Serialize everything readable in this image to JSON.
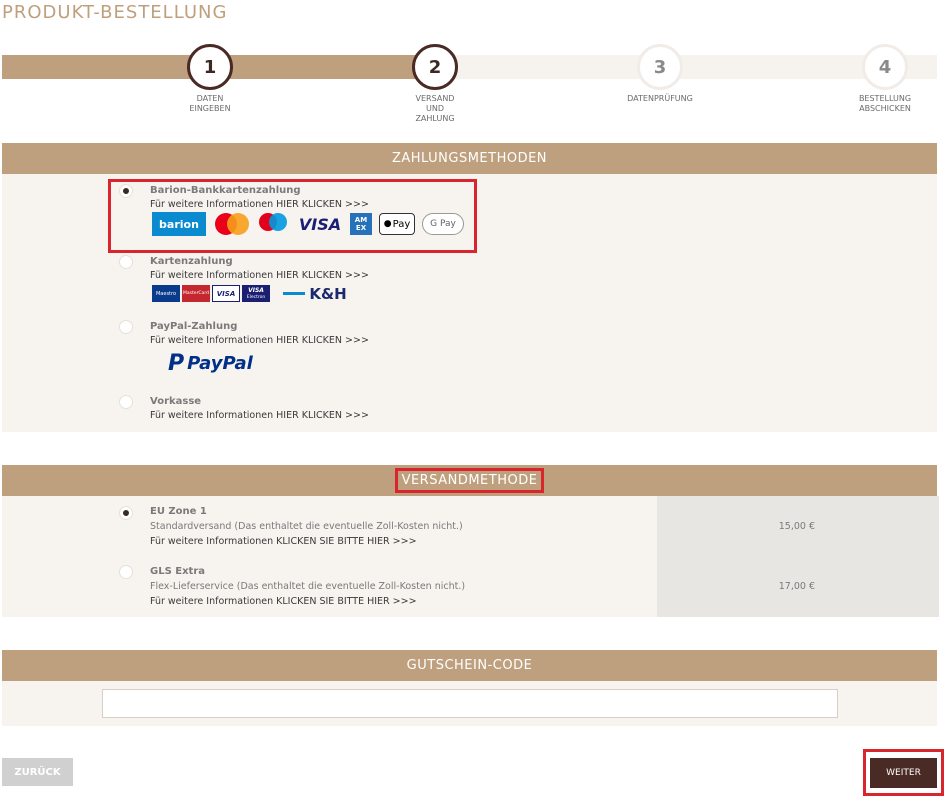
{
  "page": {
    "title": "PRODUKT-BESTELLUNG"
  },
  "steps": [
    {
      "number": "1",
      "label": "DATEN\nEINGEBEN"
    },
    {
      "number": "2",
      "label": "VERSAND\nUND\nZAHLUNG"
    },
    {
      "number": "3",
      "label": "DATENPRÜFUNG"
    },
    {
      "number": "4",
      "label": "BESTELLUNG\nABSCHICKEN"
    }
  ],
  "payment": {
    "header": "ZAHLUNGSMETHODEN",
    "options": [
      {
        "title": "Barion-Bankkartenzahlung",
        "info": "Für weitere Informationen HIER KLICKEN >>>",
        "selected": true
      },
      {
        "title": "Kartenzahlung",
        "info": "Für weitere Informationen HIER KLICKEN >>>",
        "selected": false
      },
      {
        "title": "PayPal-Zahlung",
        "info": "Für weitere Informationen HIER KLICKEN >>>",
        "selected": false
      },
      {
        "title": "Vorkasse",
        "info": "Für weitere Informationen HIER KLICKEN >>>",
        "selected": false
      }
    ],
    "logos": {
      "barion": "barion",
      "visa": "VISA",
      "amex": "AM EX",
      "applepay": "Pay",
      "googlepay": "G Pay",
      "maestro": "Maestro",
      "mastercard": "MasterCard",
      "visa_small": "VISA",
      "visa_electron_top": "VISA",
      "visa_electron_bottom": "Electron",
      "kh": "K&H",
      "paypal": "PayPal"
    }
  },
  "shipping": {
    "header": "VERSANDMETHODE",
    "options": [
      {
        "title": "EU Zone 1",
        "desc": "Standardversand (Das enthaltet die eventuelle Zoll-Kosten nicht.)",
        "info": "Für weitere Informationen KLICKEN SIE BITTE HIER >>>",
        "price": "15,00 €",
        "selected": true
      },
      {
        "title": "GLS Extra",
        "desc": "Flex-Lieferservice (Das enthaltet die eventuelle Zoll-Kosten nicht.)",
        "info": "Für weitere Informationen KLICKEN SIE BITTE HIER >>>",
        "price": "17,00 €",
        "selected": false
      }
    ]
  },
  "coupon": {
    "header": "GUTSCHEIN-CODE",
    "value": ""
  },
  "buttons": {
    "back": "ZURÜCK",
    "next": "WEITER"
  },
  "colors": {
    "accent": "#bfa07e",
    "dark": "#4a2a24",
    "highlight": "#d9262e",
    "panel": "#f7f3ef"
  }
}
